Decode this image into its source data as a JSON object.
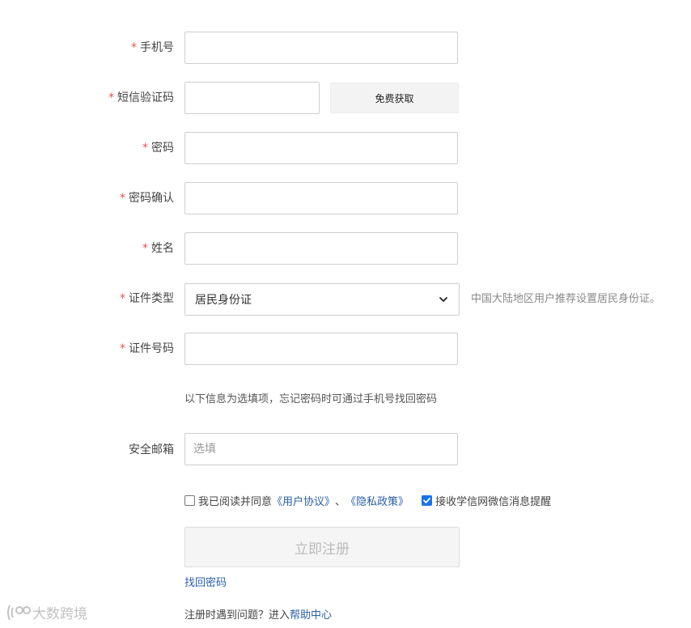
{
  "form": {
    "phone": {
      "label": "手机号",
      "required": "*",
      "value": "",
      "placeholder": ""
    },
    "sms_code": {
      "label": "短信验证码",
      "required": "*",
      "value": "",
      "placeholder": "",
      "button_label": "免费获取"
    },
    "password": {
      "label": "密码",
      "required": "*",
      "value": "",
      "placeholder": ""
    },
    "password_confirm": {
      "label": "密码确认",
      "required": "*",
      "value": "",
      "placeholder": ""
    },
    "name": {
      "label": "姓名",
      "required": "*",
      "value": "",
      "placeholder": ""
    },
    "id_type": {
      "label": "证件类型",
      "required": "*",
      "selected": "居民身份证",
      "hint": "中国大陆地区用户推荐设置居民身份证。"
    },
    "id_number": {
      "label": "证件号码",
      "required": "*",
      "value": "",
      "placeholder": ""
    },
    "optional_note": "以下信息为选填项，忘记密码时可通过手机号找回密码",
    "email": {
      "label": "安全邮箱",
      "value": "",
      "placeholder": "选填"
    }
  },
  "agreement": {
    "checked": false,
    "text": "我已阅读并同意",
    "user_agreement": "《用户协议》",
    "separator": "、",
    "privacy_policy": "《隐私政策》"
  },
  "wechat_notify": {
    "checked": true,
    "text": "接收学信网微信消息提醒"
  },
  "register_button": "立即注册",
  "forgot_password": "找回密码",
  "help": {
    "text": "注册时遇到问题？进入",
    "link": "帮助中心"
  },
  "watermark": "大数跨境",
  "colors": {
    "required": "#e2554d",
    "link": "#2b5fa8",
    "checkbox_checked": "#1a73e8"
  }
}
